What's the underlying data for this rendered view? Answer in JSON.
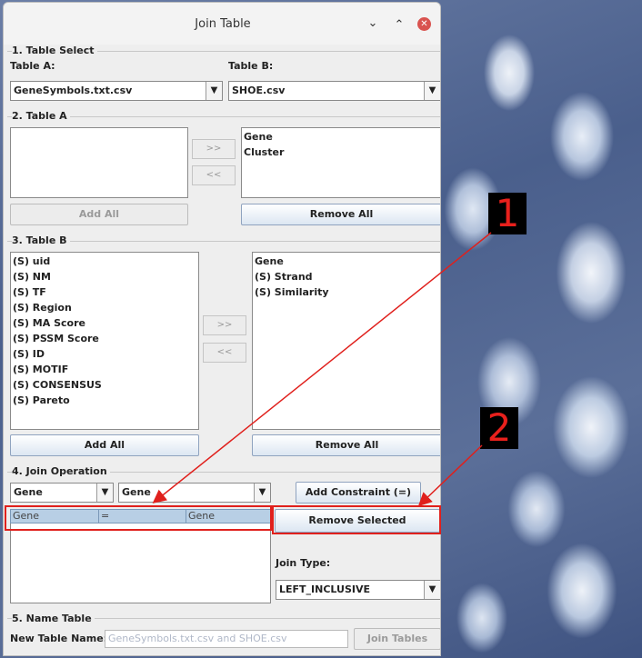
{
  "window": {
    "title": "Join Table",
    "minimize_icon": "chevron-down-icon",
    "maximize_icon": "chevron-up-icon",
    "close_icon": "close-icon"
  },
  "section1": {
    "title": "1. Table Select",
    "table_a_label": "Table A:",
    "table_a_value": "GeneSymbols.txt.csv",
    "table_b_label": "Table B:",
    "table_b_value": "SHOE.csv"
  },
  "section2": {
    "title": "2. Table A",
    "available": [],
    "selected": [
      "Gene",
      "Cluster"
    ],
    "add_btn": ">>",
    "remove_btn": "<<",
    "add_all": "Add All",
    "remove_all": "Remove All"
  },
  "section3": {
    "title": "3. Table B",
    "available": [
      "(S) uid",
      "(S) NM",
      "(S) TF",
      "(S) Region",
      "(S) MA Score",
      "(S) PSSM Score",
      "(S) ID",
      "(S) MOTIF",
      "(S) CONSENSUS",
      "(S) Pareto"
    ],
    "selected": [
      "Gene",
      "(S) Strand",
      "(S) Similarity"
    ],
    "add_btn": ">>",
    "remove_btn": "<<",
    "add_all": "Add All",
    "remove_all": "Remove All"
  },
  "section4": {
    "title": "4. Join Operation",
    "left_combo": "Gene",
    "right_combo": "Gene",
    "add_constraint": "Add Constraint (=)",
    "remove_selected": "Remove Selected",
    "constraint_row": {
      "left": "Gene",
      "op": "=",
      "right": "Gene"
    },
    "join_type_label": "Join Type:",
    "join_type_value": "LEFT_INCLUSIVE"
  },
  "section5": {
    "title": "5. Name Table",
    "name_label": "New Table Name:",
    "name_placeholder": "GeneSymbols.txt.csv and SHOE.csv",
    "join_btn": "Join Tables"
  },
  "annotations": {
    "badge1": "1",
    "badge2": "2",
    "color": "#e0201c"
  }
}
